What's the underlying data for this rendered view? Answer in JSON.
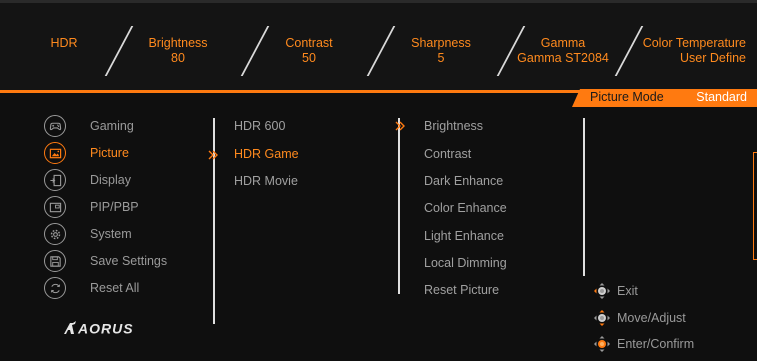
{
  "status_bar": {
    "hdr": "HDR",
    "brightness": {
      "label": "Brightness",
      "value": "80"
    },
    "contrast": {
      "label": "Contrast",
      "value": "50"
    },
    "sharpness": {
      "label": "Sharpness",
      "value": "5"
    },
    "gamma": {
      "label": "Gamma",
      "value": "Gamma ST2084"
    },
    "color_temperature": {
      "label": "Color Temperature",
      "value": "User Define"
    }
  },
  "mode_tab": {
    "label": "Picture Mode",
    "value": "Standard"
  },
  "main_menu": [
    {
      "label": "Gaming",
      "icon": "gamepad-icon",
      "active": false
    },
    {
      "label": "Picture",
      "icon": "picture-icon",
      "active": true
    },
    {
      "label": "Display",
      "icon": "display-icon",
      "active": false
    },
    {
      "label": "PIP/PBP",
      "icon": "pip-icon",
      "active": false
    },
    {
      "label": "System",
      "icon": "gear-icon",
      "active": false
    },
    {
      "label": "Save Settings",
      "icon": "save-icon",
      "active": false
    },
    {
      "label": "Reset All",
      "icon": "reset-icon",
      "active": false
    }
  ],
  "picture_submenu": [
    {
      "label": "HDR 600",
      "active": false
    },
    {
      "label": "HDR Game",
      "active": true
    },
    {
      "label": "HDR Movie",
      "active": false
    }
  ],
  "setting_items": [
    {
      "label": "Brightness"
    },
    {
      "label": "Contrast"
    },
    {
      "label": "Dark Enhance"
    },
    {
      "label": "Color Enhance"
    },
    {
      "label": "Light Enhance"
    },
    {
      "label": "Local Dimming"
    },
    {
      "label": "Reset Picture"
    }
  ],
  "help": [
    {
      "label": "Exit",
      "icon": "dpad-left-icon"
    },
    {
      "label": "Move/Adjust",
      "icon": "dpad-updown-icon"
    },
    {
      "label": "Enter/Confirm",
      "icon": "dpad-right-icon"
    }
  ],
  "brand": "AORUS",
  "colors": {
    "accent": "#ff7a10",
    "text": "#9a9a9a",
    "background": "#0f0f0f"
  }
}
